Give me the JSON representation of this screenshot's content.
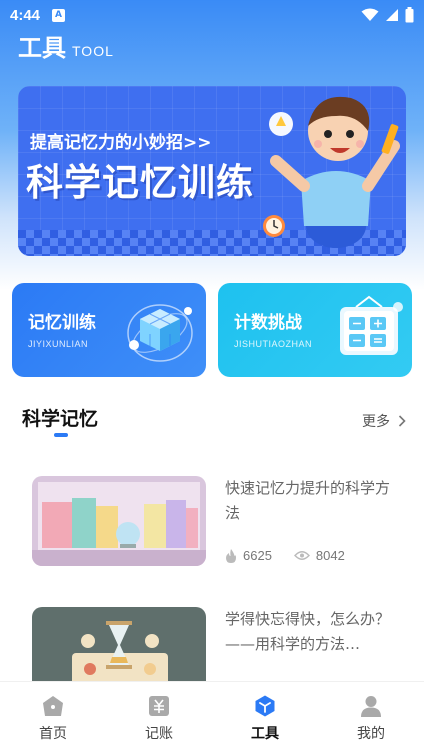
{
  "status_bar": {
    "time": "4:44",
    "app_icon": "A",
    "icons": [
      "wifi-icon",
      "signal-icon",
      "battery-icon"
    ]
  },
  "header": {
    "title": "工具",
    "subtitle": "TOOL"
  },
  "banner": {
    "subtitle": "提高记忆力的小妙招>>",
    "title": "科学记忆训练"
  },
  "cards": [
    {
      "title": "记忆训练",
      "subtitle": "JIYIXUNLIAN",
      "color": "#2b7af5"
    },
    {
      "title": "计数挑战",
      "subtitle": "JISHUTIAOZHAN",
      "color": "#1ec1ef"
    }
  ],
  "section": {
    "title": "科学记忆",
    "more_label": "更多"
  },
  "articles": [
    {
      "title": "快速记忆力提升的科学方法",
      "likes": "6625",
      "views": "8042"
    },
    {
      "title": "学得快忘得快，怎么办？——用科学的方法…"
    }
  ],
  "tabbar": {
    "tabs": [
      {
        "label": "首页",
        "icon": "home-icon",
        "active": false
      },
      {
        "label": "记账",
        "icon": "ledger-icon",
        "active": false
      },
      {
        "label": "工具",
        "icon": "cube-icon",
        "active": true
      },
      {
        "label": "我的",
        "icon": "profile-icon",
        "active": false
      }
    ],
    "active_color": "#2b7af5"
  }
}
